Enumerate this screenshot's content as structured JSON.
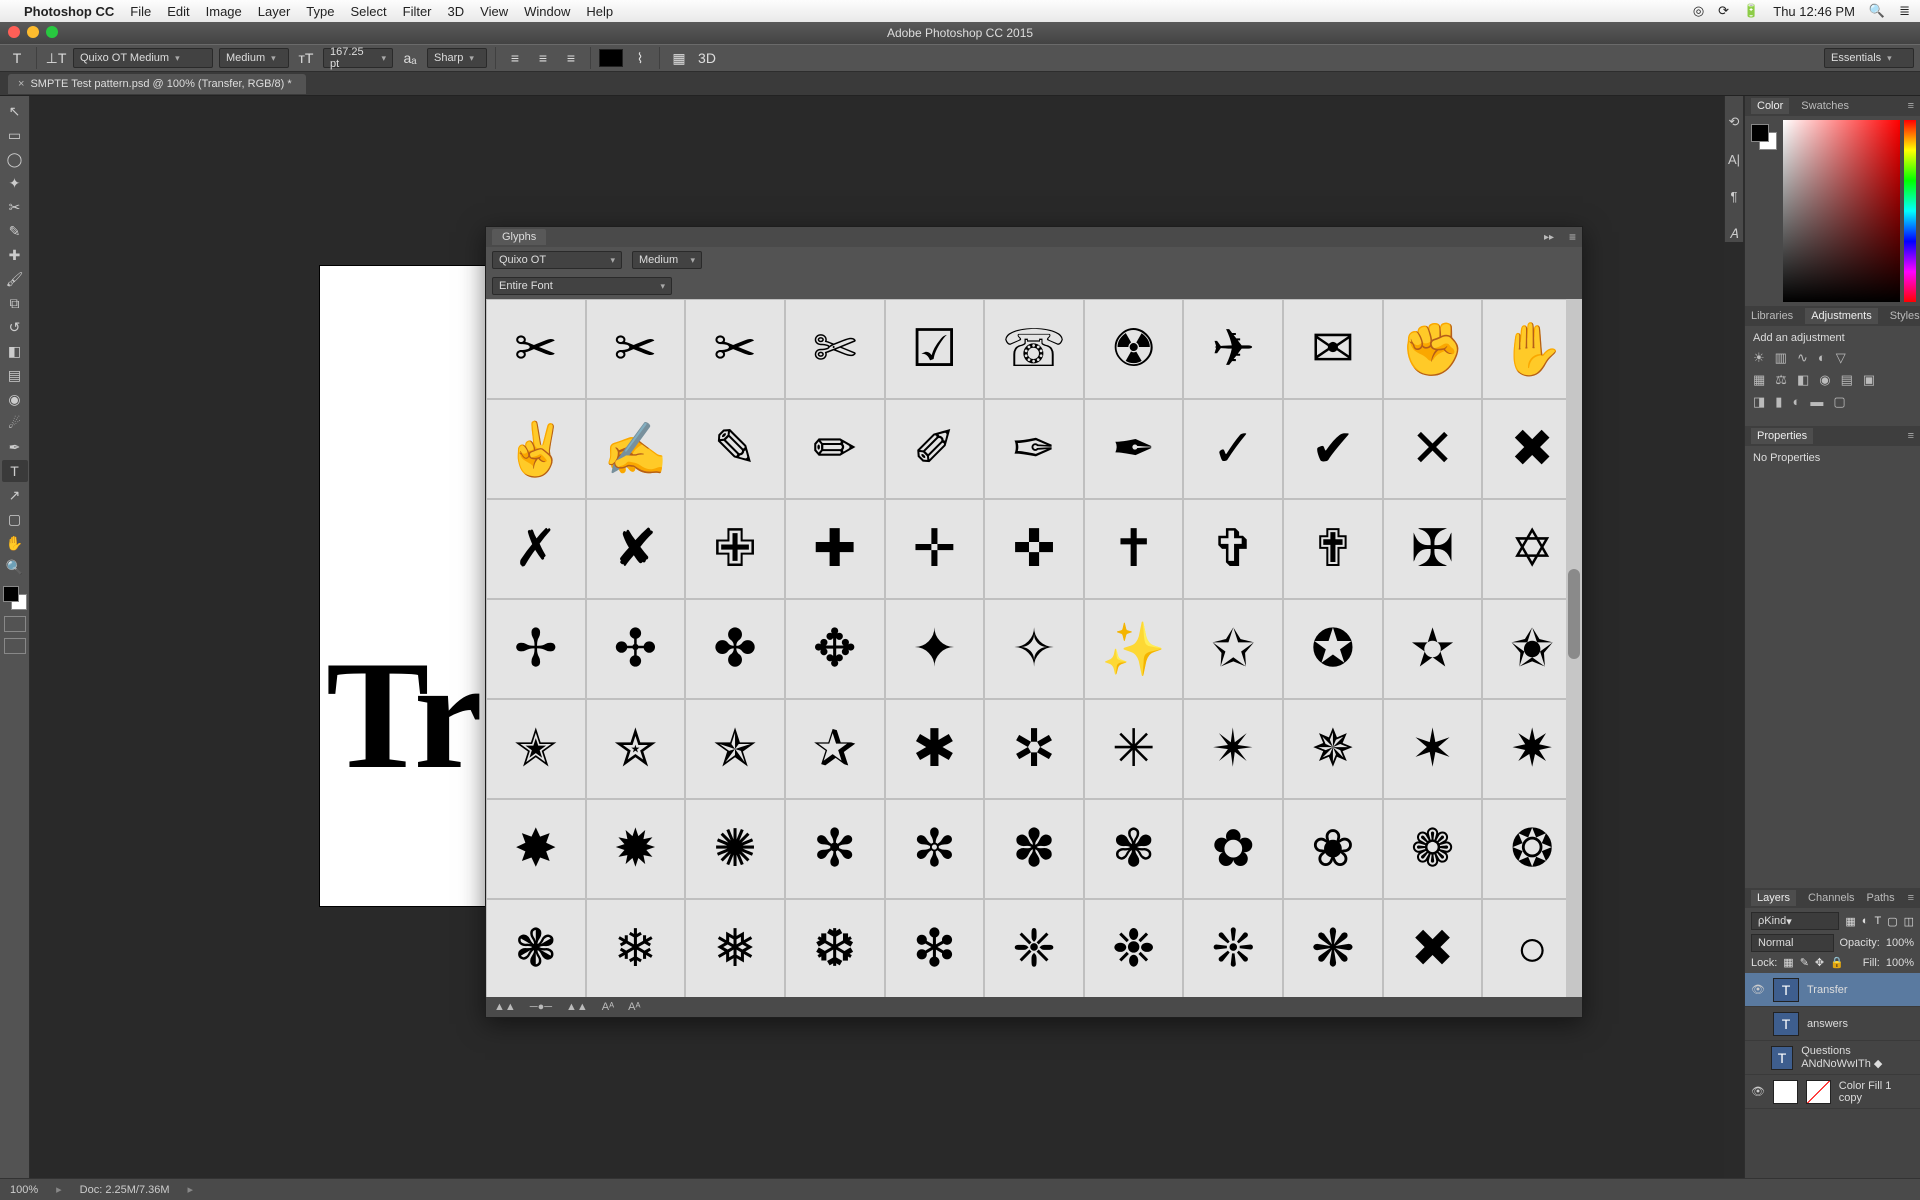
{
  "mac_menu": {
    "app": "Photoshop CC",
    "items": [
      "File",
      "Edit",
      "Image",
      "Layer",
      "Type",
      "Select",
      "Filter",
      "3D",
      "View",
      "Window",
      "Help"
    ],
    "right": [
      "◎",
      "⟳",
      "🔋",
      "Thu 12:46 PM",
      "🔍",
      "≣"
    ]
  },
  "title_bar": "Adobe Photoshop CC 2015",
  "options_bar": {
    "font_family": "Quixo OT Medium",
    "font_style": "Medium",
    "font_size": "167.25 pt",
    "aa": "Sharp",
    "workspace_switcher": "Essentials"
  },
  "doc_tab": "SMPTE Test pattern.psd @ 100% (Transfer, RGB/8) *",
  "canvas_text": "Tr",
  "glyphs_panel": {
    "title": "Glyphs",
    "font": "Quixo OT",
    "style": "Medium",
    "subset": "Entire Font",
    "footer_icons": [
      "▲▲",
      "─●─",
      "▲▲",
      "Aᴬ",
      "Aᴬ"
    ],
    "cells": [
      "✂",
      "✂",
      "✂",
      "✄",
      "☑",
      "☏",
      "☢",
      "✈",
      "✉",
      "✊",
      "✋",
      "✌",
      "✍",
      "✎",
      "✏",
      "✐",
      "✑",
      "✒",
      "✓",
      "✔",
      "✕",
      "✖",
      "✗",
      "✘",
      "✙",
      "✚",
      "✛",
      "✜",
      "✝",
      "✞",
      "✟",
      "✠",
      "✡",
      "✢",
      "✣",
      "✤",
      "✥",
      "✦",
      "✧",
      "✨",
      "✩",
      "✪",
      "✫",
      "✬",
      "✭",
      "✮",
      "✯",
      "✰",
      "✱",
      "✲",
      "✳",
      "✴",
      "✵",
      "✶",
      "✷",
      "✸",
      "✹",
      "✺",
      "✻",
      "✼",
      "✽",
      "✾",
      "✿",
      "❀",
      "❁",
      "❂",
      "❃",
      "❄",
      "❅",
      "❆",
      "❇",
      "❈",
      "❉",
      "❊",
      "❋",
      "✖",
      "○"
    ]
  },
  "right_panels": {
    "color_tab": "Color",
    "swatches_tab": "Swatches",
    "libraries_tab": "Libraries",
    "adjustments_tab": "Adjustments",
    "styles_tab": "Styles",
    "add_adjustment": "Add an adjustment",
    "properties_tab": "Properties",
    "no_properties": "No Properties",
    "layers_tab": "Layers",
    "channels_tab": "Channels",
    "paths_tab": "Paths",
    "kind": "Kind",
    "blend": "Normal",
    "opacity_label": "Opacity:",
    "opacity_val": "100%",
    "lock_label": "Lock:",
    "fill_label": "Fill:",
    "fill_val": "100%",
    "layers": [
      {
        "name": "Transfer",
        "type": "T",
        "visible": true,
        "selected": true
      },
      {
        "name": "answers",
        "type": "T",
        "visible": false,
        "selected": false
      },
      {
        "name": "Questions ANdNoWwITh ◆",
        "type": "T",
        "visible": false,
        "selected": false
      },
      {
        "name": "Color Fill 1 copy",
        "type": "fill",
        "visible": true,
        "selected": false
      }
    ]
  },
  "status": {
    "zoom": "100%",
    "doc": "Doc: 2.25M/7.36M"
  }
}
